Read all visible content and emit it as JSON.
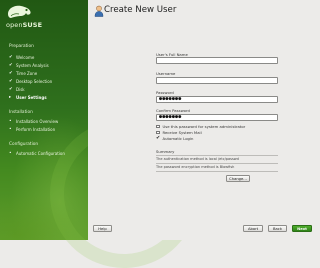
{
  "brand": {
    "logo_text_light": "open",
    "logo_text_bold": "SUSE"
  },
  "sidebar": {
    "sections": [
      {
        "title": "Preparation",
        "items": [
          {
            "label": "Welcome",
            "state": "done"
          },
          {
            "label": "System Analysis",
            "state": "done"
          },
          {
            "label": "Time Zone",
            "state": "done"
          },
          {
            "label": "Desktop Selection",
            "state": "done"
          },
          {
            "label": "Disk",
            "state": "done"
          },
          {
            "label": "User Settings",
            "state": "current"
          }
        ]
      },
      {
        "title": "Installation",
        "items": [
          {
            "label": "Installation Overview",
            "state": "pending"
          },
          {
            "label": "Perform Installation",
            "state": "pending"
          }
        ]
      },
      {
        "title": "Configuration",
        "items": [
          {
            "label": "Automatic Configuration",
            "state": "pending"
          }
        ]
      }
    ]
  },
  "main": {
    "title": "Create New User",
    "title_icon": "user-icon",
    "full_name": {
      "label": "User's Full Name",
      "value": ""
    },
    "username": {
      "label": "Username",
      "value": ""
    },
    "password": {
      "label": "Password",
      "value": "●●●●●●●"
    },
    "confirm_password": {
      "label": "Confirm Password",
      "value": "●●●●●●●"
    },
    "options": {
      "use_for_admin": "Use this password for system administrator",
      "receive_mail": "Receive System Mail",
      "autologin": "Automatic Login"
    },
    "summary": {
      "heading": "Summary",
      "auth_line": "The authentication method is local /etc/passwd",
      "encryption_line": "The password encryption method is Blowfish",
      "change_button": "Change..."
    }
  },
  "footer": {
    "help": "Help",
    "abort": "Abort",
    "back": "Back",
    "next": "Next"
  },
  "colors": {
    "sidebar_top": "#215813",
    "sidebar_bottom": "#5e9d2c",
    "accent": "#3a9a1e"
  }
}
